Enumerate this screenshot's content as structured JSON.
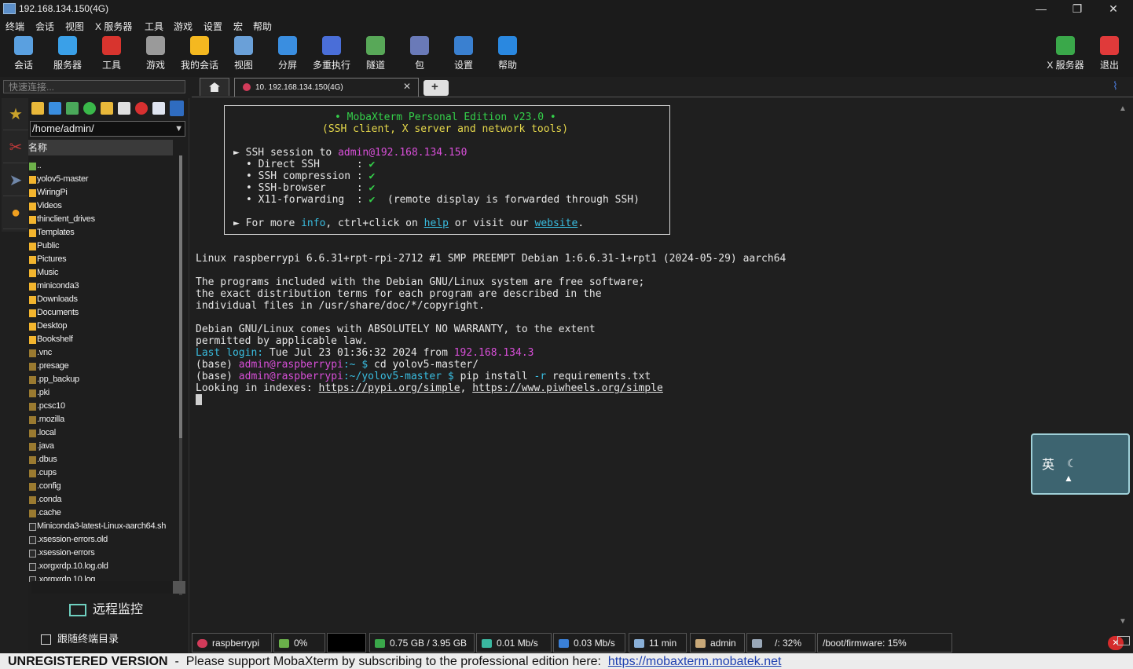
{
  "window": {
    "title": "192.168.134.150(4G)",
    "controls": [
      "—",
      "❐",
      "✕"
    ]
  },
  "menu": [
    "终端",
    "会话",
    "视图",
    "X 服务器",
    "工具",
    "游戏",
    "设置",
    "宏",
    "帮助"
  ],
  "toolbar": {
    "left": [
      {
        "label": "会话",
        "icon": "session-icon",
        "color": "#5aa0e0"
      },
      {
        "label": "服务器",
        "icon": "servers-icon",
        "color": "#3aa0e8"
      },
      {
        "label": "工具",
        "icon": "tools-icon",
        "color": "#d8342e"
      },
      {
        "label": "游戏",
        "icon": "gamepad-icon",
        "color": "#9a9a9a"
      },
      {
        "label": "我的会话",
        "icon": "star-icon",
        "color": "#f4b820"
      },
      {
        "label": "视图",
        "icon": "view-icon",
        "color": "#6aa0d8"
      },
      {
        "label": "分屏",
        "icon": "split-icon",
        "color": "#3a8ee0"
      },
      {
        "label": "多重执行",
        "icon": "multiexec-icon",
        "color": "#4a6ed8"
      },
      {
        "label": "隧道",
        "icon": "tunnel-icon",
        "color": "#58a858"
      },
      {
        "label": "包",
        "icon": "packages-icon",
        "color": "#6a7ab8"
      },
      {
        "label": "设置",
        "icon": "settings-icon",
        "color": "#3a80d0"
      },
      {
        "label": "帮助",
        "icon": "help-icon",
        "color": "#2a88e0"
      }
    ],
    "right": [
      {
        "label": "X 服务器",
        "icon": "xserver-icon",
        "color": "#3aa84a"
      },
      {
        "label": "退出",
        "icon": "power-icon",
        "color": "#e03a3a"
      }
    ]
  },
  "quick_connect": {
    "placeholder": "快速连接..."
  },
  "tabs": {
    "session_tab": "10. 192.168.134.150(4G)"
  },
  "sidebar": {
    "path": "/home/admin/",
    "column_header": "名称",
    "files": [
      {
        "name": "..",
        "type": "up"
      },
      {
        "name": "yolov5-master",
        "type": "folder"
      },
      {
        "name": "WiringPi",
        "type": "folder"
      },
      {
        "name": "Videos",
        "type": "folder"
      },
      {
        "name": "thinclient_drives",
        "type": "folder"
      },
      {
        "name": "Templates",
        "type": "folder"
      },
      {
        "name": "Public",
        "type": "folder"
      },
      {
        "name": "Pictures",
        "type": "folder"
      },
      {
        "name": "Music",
        "type": "folder"
      },
      {
        "name": "miniconda3",
        "type": "folder"
      },
      {
        "name": "Downloads",
        "type": "folder"
      },
      {
        "name": "Documents",
        "type": "folder"
      },
      {
        "name": "Desktop",
        "type": "folder"
      },
      {
        "name": "Bookshelf",
        "type": "folder"
      },
      {
        "name": ".vnc",
        "type": "hidden"
      },
      {
        "name": ".presage",
        "type": "hidden"
      },
      {
        "name": ".pp_backup",
        "type": "hidden"
      },
      {
        "name": ".pki",
        "type": "hidden"
      },
      {
        "name": ".pcsc10",
        "type": "hidden"
      },
      {
        "name": ".mozilla",
        "type": "hidden"
      },
      {
        "name": ".local",
        "type": "hidden"
      },
      {
        "name": ".java",
        "type": "hidden"
      },
      {
        "name": ".dbus",
        "type": "hidden"
      },
      {
        "name": ".cups",
        "type": "hidden"
      },
      {
        "name": ".config",
        "type": "hidden"
      },
      {
        "name": ".conda",
        "type": "hidden"
      },
      {
        "name": ".cache",
        "type": "hidden"
      },
      {
        "name": "Miniconda3-latest-Linux-aarch64.sh",
        "type": "file"
      },
      {
        "name": ".xsession-errors.old",
        "type": "file"
      },
      {
        "name": ".xsession-errors",
        "type": "file"
      },
      {
        "name": ".xorgxrdp.10.log.old",
        "type": "file"
      },
      {
        "name": ".xorgxrdp.10.log",
        "type": "file"
      }
    ],
    "remote_monitor": "远程监控",
    "follow_terminal": "跟随终端目录"
  },
  "terminal": {
    "banner_title": "• MobaXterm Personal Edition v23.0 •",
    "banner_subtitle": "(SSH client, X server and network tools)",
    "ssh_session_prefix": "► SSH session to ",
    "ssh_target": "admin@192.168.134.150",
    "features": [
      {
        "name": "• Direct SSH      :",
        "mark": "✔",
        "note": ""
      },
      {
        "name": "• SSH compression :",
        "mark": "✔",
        "note": ""
      },
      {
        "name": "• SSH-browser     :",
        "mark": "✔",
        "note": ""
      },
      {
        "name": "• X11-forwarding  :",
        "mark": "✔",
        "note": "(remote display is forwarded through SSH)"
      }
    ],
    "more_info": {
      "p1": "► For more ",
      "info": "info",
      "p2": ", ctrl+click on ",
      "help": "help",
      "p3": " or visit our ",
      "website": "website",
      "p4": "."
    },
    "lines": {
      "uname": "Linux raspberrypi 6.6.31+rpt-rpi-2712 #1 SMP PREEMPT Debian 1:6.6.31-1+rpt1 (2024-05-29) aarch64",
      "l1": "The programs included with the Debian GNU/Linux system are free software;",
      "l2": "the exact distribution terms for each program are described in the",
      "l3": "individual files in /usr/share/doc/*/copyright.",
      "l4": "Debian GNU/Linux comes with ABSOLUTELY NO WARRANTY, to the extent",
      "l5": "permitted by applicable law.",
      "last_login_label": "Last login:",
      "last_login_value": " Tue Jul 23 01:36:32 2024 from ",
      "last_login_ip": "192.168.134.3",
      "p1_base": "(base) ",
      "p1_user": "admin@raspberrypi",
      "p1_path": ":~ $ ",
      "p1_cmd": "cd yolov5-master/",
      "p2_base": "(base) ",
      "p2_user": "admin@raspberrypi",
      "p2_path": ":~/yolov5-master $ ",
      "p2_cmd1": "pip install ",
      "p2_flag": "-r",
      "p2_cmd2": " requirements.txt",
      "idx_prefix": "Looking in indexes: ",
      "idx_url1": "https://pypi.org/simple",
      "idx_sep": ", ",
      "idx_url2": "https://www.piwheels.org/simple"
    }
  },
  "ime": {
    "mode": "英"
  },
  "statusbar": {
    "host": "raspberrypi",
    "cpu": "0%",
    "memory": "0.75 GB / 3.95 GB",
    "upload": "0.01 Mb/s",
    "download": "0.03 Mb/s",
    "uptime": "11 min",
    "user": "admin",
    "disk_root": "/: 32%",
    "disk_boot": "/boot/firmware: 15%"
  },
  "footer": {
    "unregistered": "UNREGISTERED VERSION",
    "separator": "  -  ",
    "message": "Please support MobaXterm by subscribing to the professional edition here:  ",
    "link": "https://mobaxterm.mobatek.net"
  }
}
